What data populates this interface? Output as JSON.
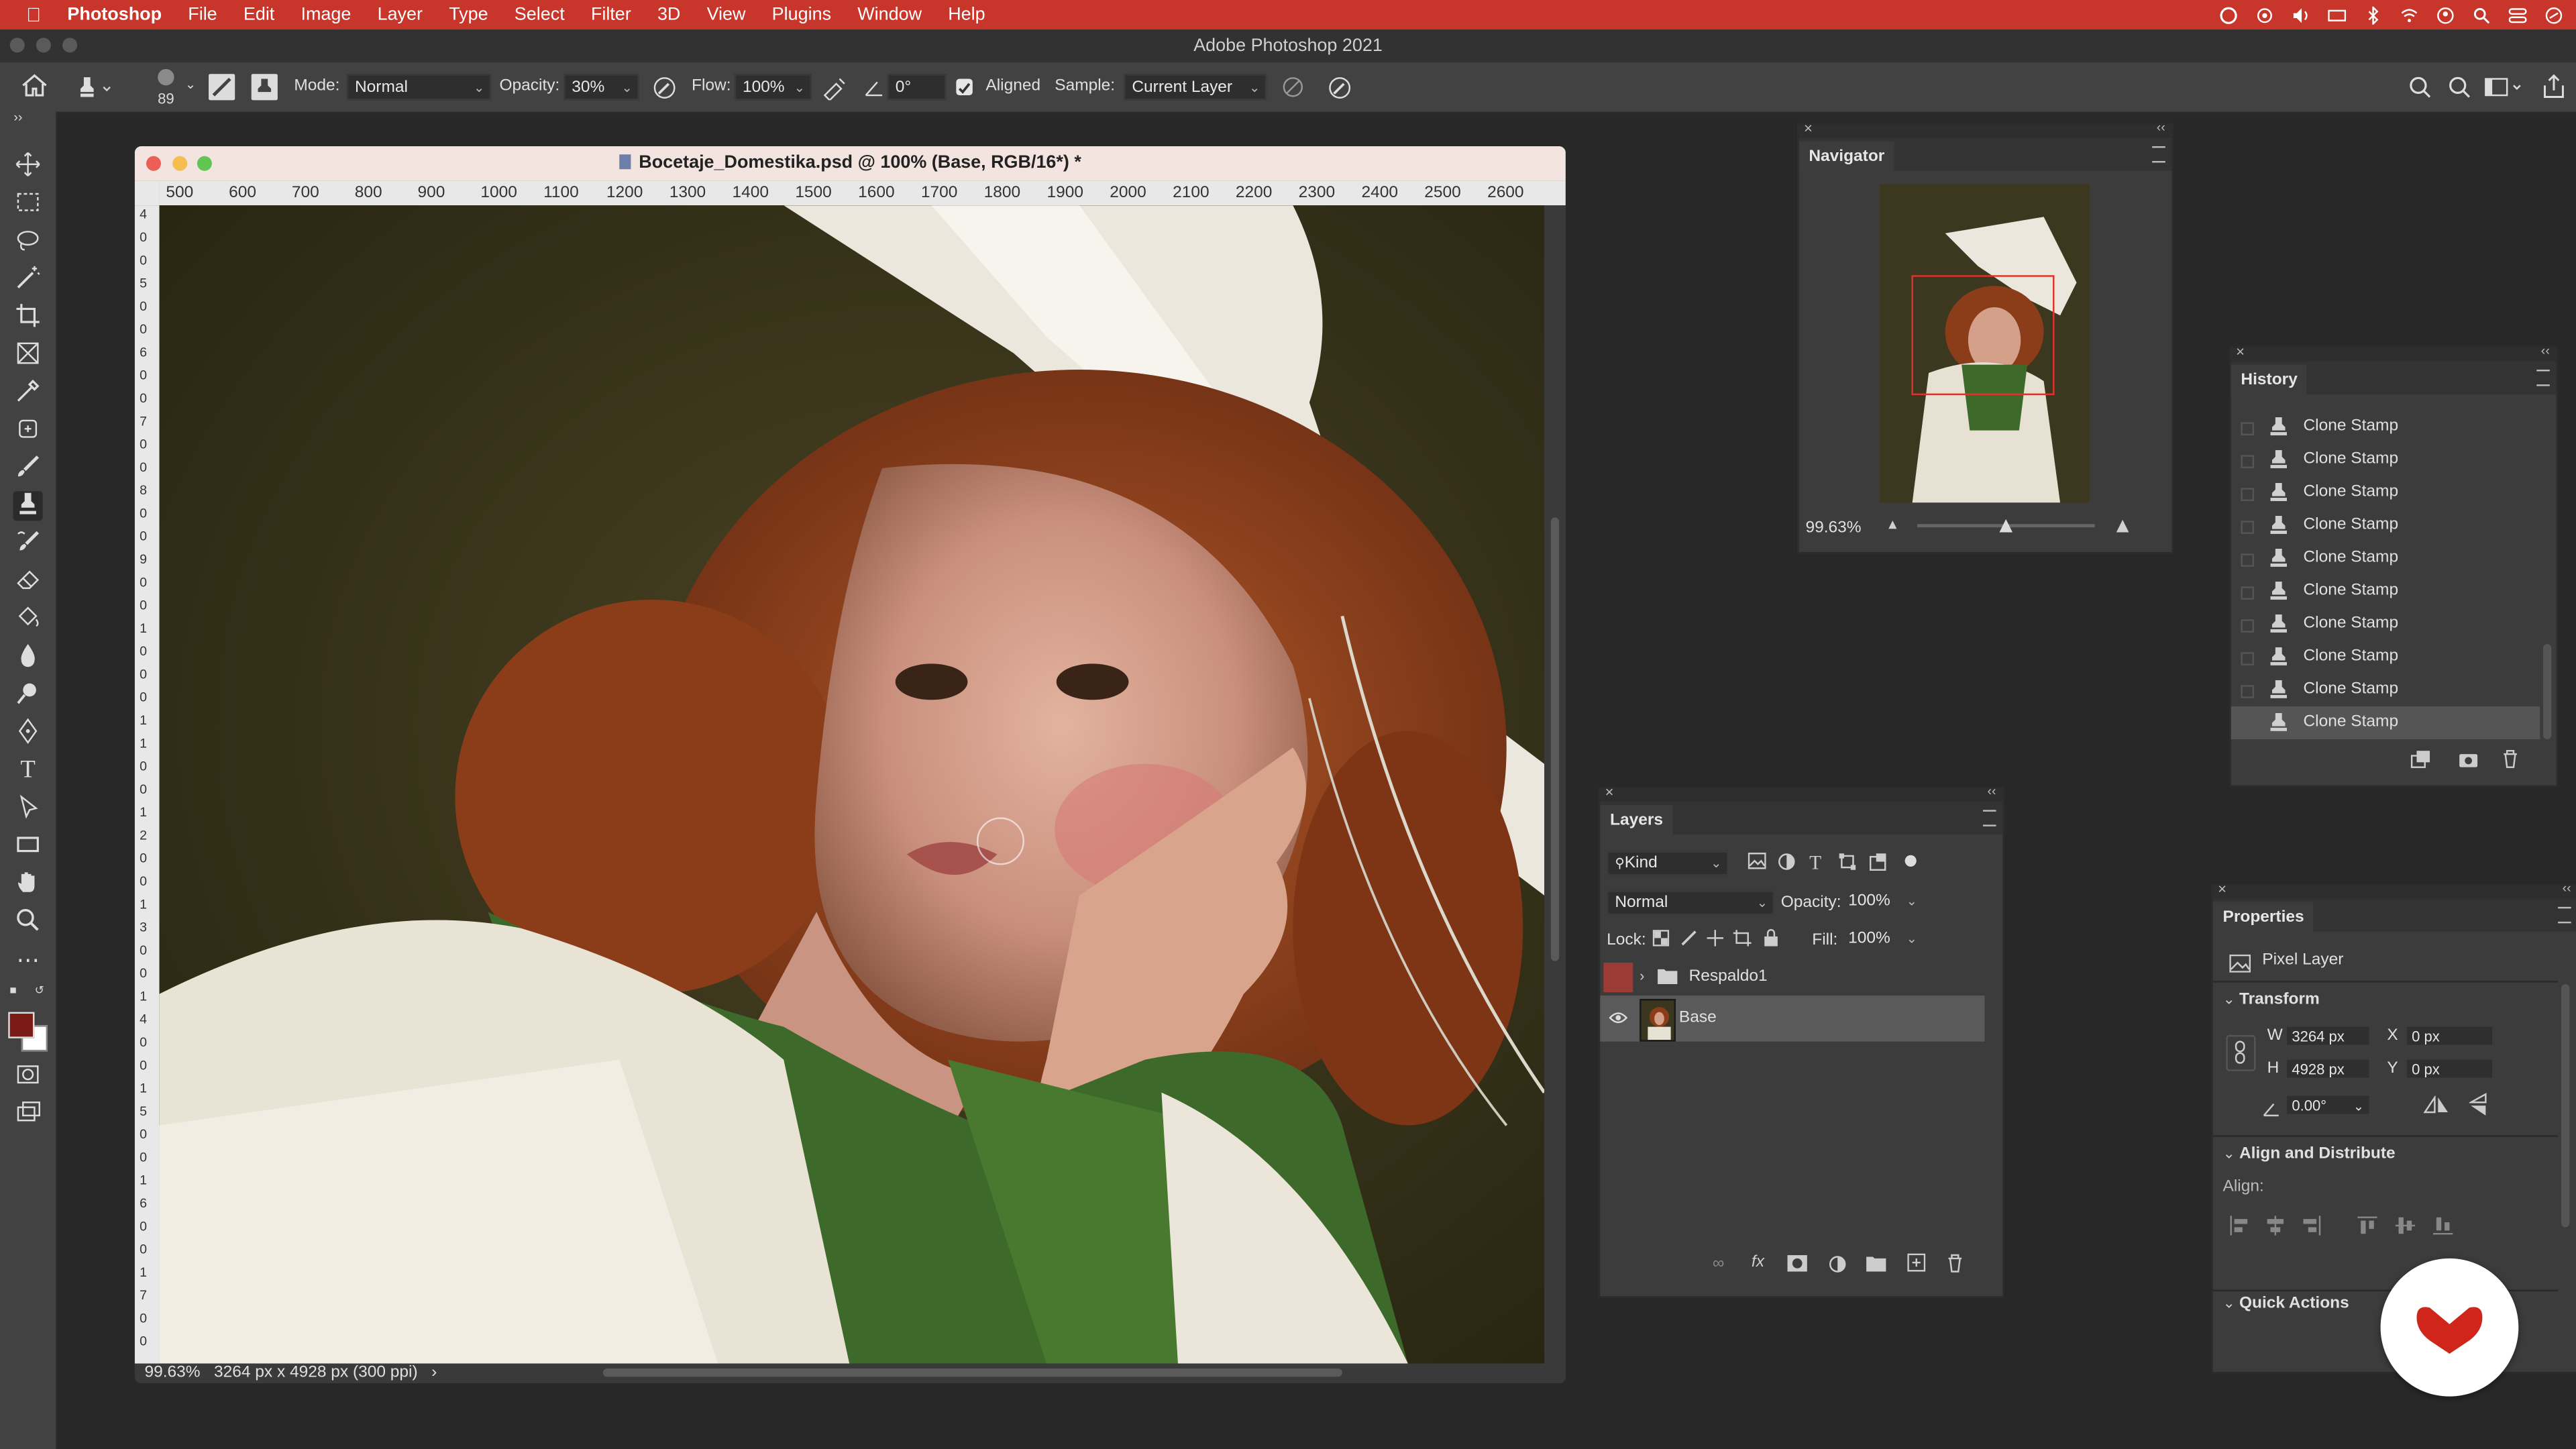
{
  "menubar": {
    "apple": "",
    "app_name": "Photoshop",
    "items": [
      "File",
      "Edit",
      "Image",
      "Layer",
      "Type",
      "Select",
      "Filter",
      "3D",
      "View",
      "Plugins",
      "Window",
      "Help"
    ]
  },
  "app_title": "Adobe Photoshop 2021",
  "options": {
    "brush_size": "89",
    "mode_label": "Mode:",
    "mode_value": "Normal",
    "opacity_label": "Opacity:",
    "opacity_value": "30%",
    "flow_label": "Flow:",
    "flow_value": "100%",
    "angle_value": "0°",
    "aligned_label": "Aligned",
    "sample_label": "Sample:",
    "sample_value": "Current Layer"
  },
  "document": {
    "title": "Bocetaje_Domestika.psd @ 100% (Base, RGB/16*) *",
    "ruler_h": [
      "500",
      "600",
      "700",
      "800",
      "900",
      "1000",
      "1100",
      "1200",
      "1300",
      "1400",
      "1500",
      "1600",
      "1700",
      "1800",
      "1900",
      "2000",
      "2100",
      "2200",
      "2300",
      "2400",
      "2500",
      "2600"
    ],
    "ruler_v": [
      "4",
      "0",
      "0",
      "5",
      "0",
      "0",
      "6",
      "0",
      "0",
      "7",
      "0",
      "0",
      "8",
      "0",
      "0",
      "9",
      "0",
      "0",
      "1",
      "0",
      "0",
      "0",
      "1",
      "1",
      "0",
      "0",
      "1",
      "2",
      "0",
      "0",
      "1",
      "3",
      "0",
      "0",
      "1",
      "4",
      "0",
      "0",
      "1",
      "5",
      "0",
      "0",
      "1",
      "6",
      "0",
      "0",
      "1",
      "7",
      "0",
      "0"
    ],
    "zoom": "99.63%",
    "dimensions": "3264 px x 4928 px (300 ppi)"
  },
  "navigator": {
    "title": "Navigator",
    "zoom": "99.63%",
    "zoom_slider_fraction": 0.5
  },
  "history": {
    "title": "History",
    "items": [
      "Clone Stamp",
      "Clone Stamp",
      "Clone Stamp",
      "Clone Stamp",
      "Clone Stamp",
      "Clone Stamp",
      "Clone Stamp",
      "Clone Stamp",
      "Clone Stamp",
      "Clone Stamp"
    ]
  },
  "layers": {
    "title": "Layers",
    "filter_kind": "Kind",
    "blend_mode": "Normal",
    "opacity_label": "Opacity:",
    "opacity_value": "100%",
    "lock_label": "Lock:",
    "fill_label": "Fill:",
    "fill_value": "100%",
    "items": [
      {
        "name": "Respaldo1",
        "type": "group"
      },
      {
        "name": "Base",
        "type": "pixel"
      }
    ]
  },
  "properties": {
    "title": "Properties",
    "layer_type": "Pixel Layer",
    "transform_header": "Transform",
    "w_label": "W",
    "w_value": "3264 px",
    "h_label": "H",
    "h_value": "4928 px",
    "x_label": "X",
    "x_value": "0 px",
    "y_label": "Y",
    "y_value": "0 px",
    "angle_value": "0.00°",
    "align_header": "Align and Distribute",
    "align_label": "Align:",
    "quick_actions_header": "Quick Actions"
  },
  "colors": {
    "menubar_bg": "#c8352a",
    "foreground_swatch": "#7a1a16",
    "background_swatch": "#ffffff",
    "logo_red": "#d0251b"
  }
}
